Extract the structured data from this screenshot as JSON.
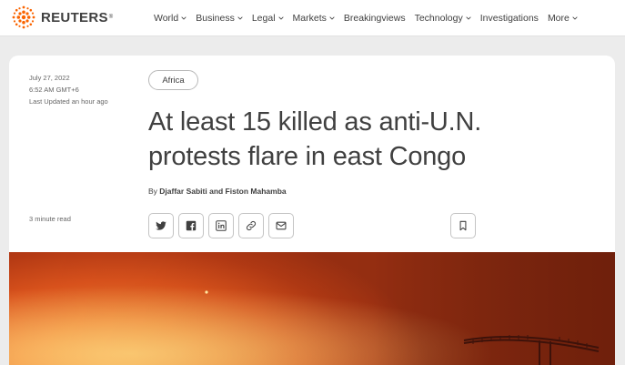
{
  "brand": {
    "name": "REUTERS",
    "registered": "®"
  },
  "nav": [
    {
      "label": "World",
      "chevron": true
    },
    {
      "label": "Business",
      "chevron": true
    },
    {
      "label": "Legal",
      "chevron": true
    },
    {
      "label": "Markets",
      "chevron": true
    },
    {
      "label": "Breakingviews",
      "chevron": false
    },
    {
      "label": "Technology",
      "chevron": true
    },
    {
      "label": "Investigations",
      "chevron": false
    },
    {
      "label": "More",
      "chevron": true
    }
  ],
  "article": {
    "date": "July 27, 2022",
    "time": "6:52 AM GMT+6",
    "updated": "Last Updated an hour ago",
    "tag": "Africa",
    "headline": "At least 15 killed as anti-U.N. protests flare in east Congo",
    "byline_prefix": "By",
    "authors": "Djaffar Sabiti and Fiston Mahamba",
    "read_time": "3 minute read"
  },
  "share_buttons": [
    "twitter-icon",
    "facebook-icon",
    "linkedin-icon",
    "link-icon",
    "email-icon"
  ],
  "bookmark_icon": "bookmark-icon",
  "colors": {
    "brand_orange": "#fa6400",
    "text": "#404040",
    "photo_glow": "#f7a24a"
  }
}
